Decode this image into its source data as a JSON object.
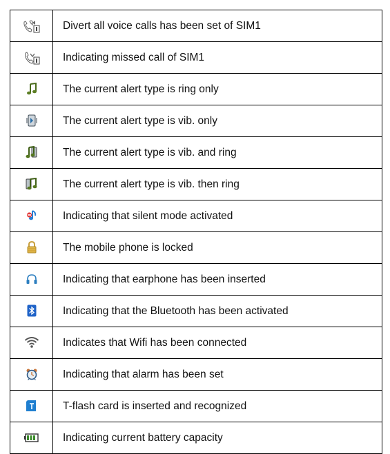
{
  "rows": [
    {
      "icon": "call-divert-sim1-icon",
      "text": "Divert all voice calls has been set of SIM1"
    },
    {
      "icon": "missed-call-sim1-icon",
      "text": "Indicating missed call of SIM1"
    },
    {
      "icon": "ring-only-icon",
      "text": "The current alert type is ring only"
    },
    {
      "icon": "vib-only-icon",
      "text": "The current alert type is vib. only"
    },
    {
      "icon": "vib-and-ring-icon",
      "text": "The current alert type is vib. and ring"
    },
    {
      "icon": "vib-then-ring-icon",
      "text": "The current alert type is vib. then ring"
    },
    {
      "icon": "silent-mode-icon",
      "text": "Indicating that silent mode activated"
    },
    {
      "icon": "phone-locked-icon",
      "text": "The mobile phone is locked"
    },
    {
      "icon": "earphone-icon",
      "text": "Indicating that earphone has been inserted"
    },
    {
      "icon": "bluetooth-icon",
      "text": "Indicating that the Bluetooth has been activated"
    },
    {
      "icon": "wifi-icon",
      "text": "Indicates that Wifi has been connected"
    },
    {
      "icon": "alarm-icon",
      "text": "Indicating that alarm has been set"
    },
    {
      "icon": "tflash-card-icon",
      "text": "T-flash card is inserted and recognized"
    },
    {
      "icon": "battery-icon",
      "text": "Indicating current battery capacity"
    }
  ]
}
